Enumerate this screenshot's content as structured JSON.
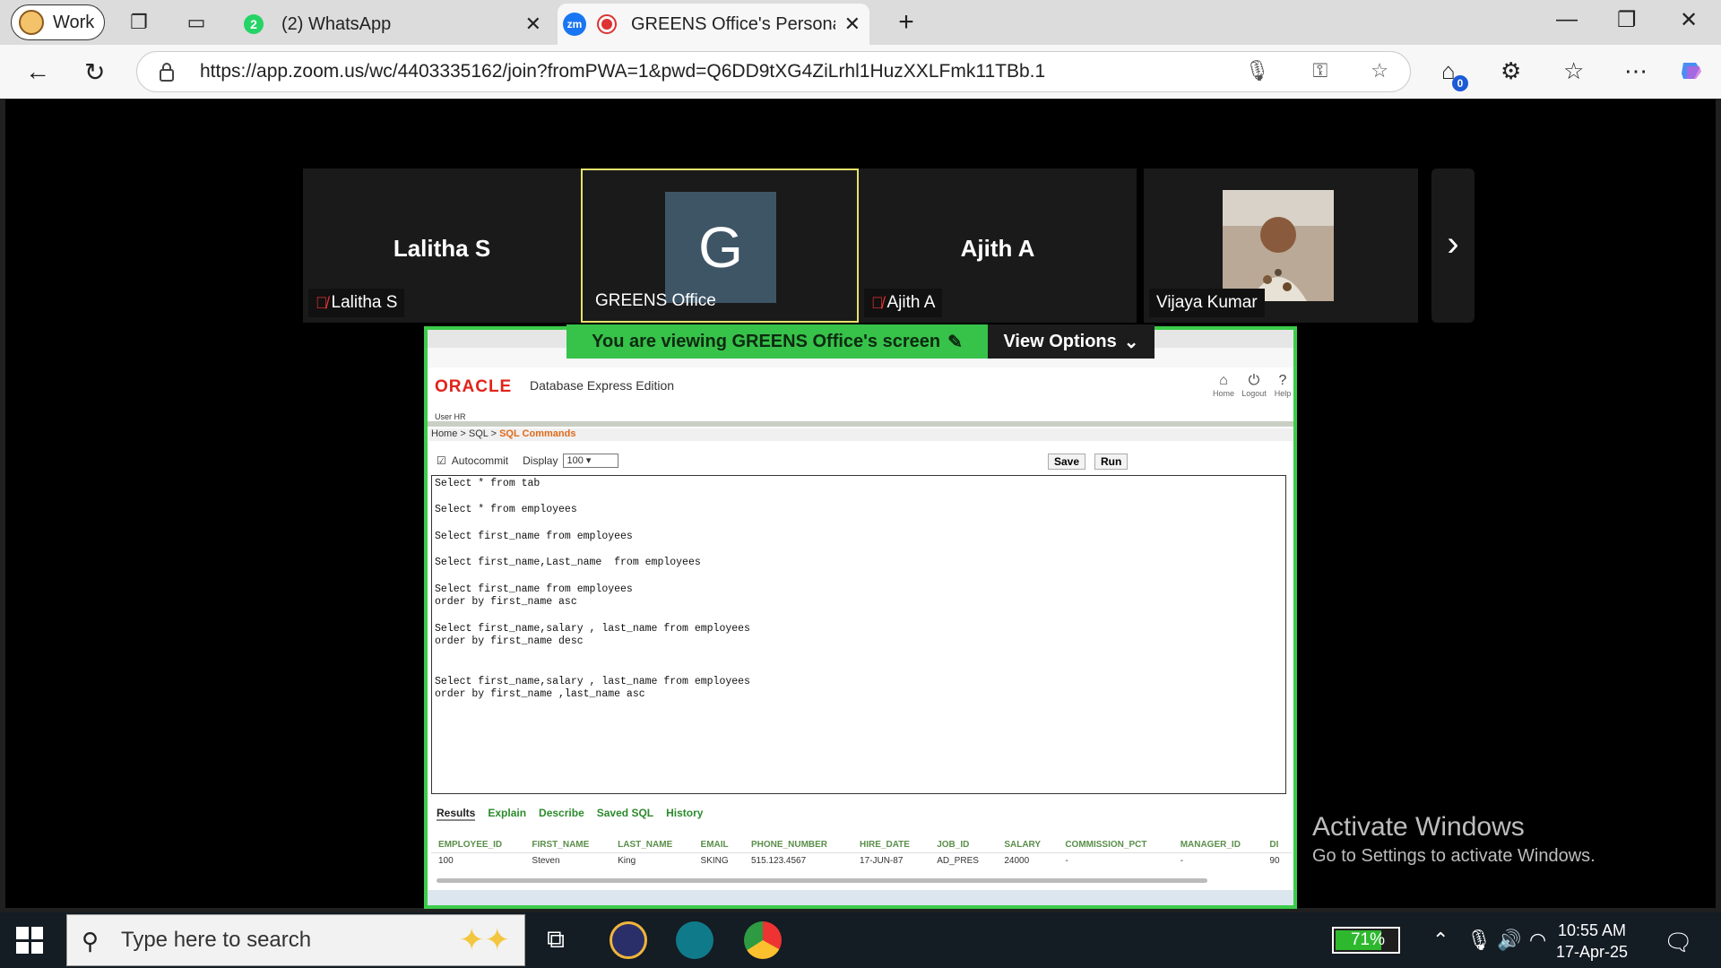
{
  "browser": {
    "profile_label": "Work",
    "tabs": [
      {
        "label": "(2) WhatsApp",
        "badge": "2"
      },
      {
        "label": "GREENS Office's Personal Me",
        "icon_text": "zm"
      }
    ],
    "url": "https://app.zoom.us/wc/4403335162/join?fromPWA=1&pwd=Q6DD9tXG4ZiLrhl1HuzXXLFmk11TBb.1",
    "extensions_badge": "0"
  },
  "meeting": {
    "participants": [
      {
        "display": "Lalitha S",
        "tag": "Lalitha S",
        "muted": true
      },
      {
        "display": "G",
        "tag": "GREENS Office",
        "muted": false
      },
      {
        "display": "Ajith A",
        "tag": "Ajith A",
        "muted": true
      },
      {
        "display": "",
        "tag": "Vijaya Kumar",
        "muted": false
      }
    ],
    "share_banner": "You are viewing  GREENS Office's screen",
    "view_options": "View Options"
  },
  "shared_screen": {
    "oracle_logo": "ORACLE",
    "product": "Database Express Edition",
    "nav": [
      "Home",
      "Logout",
      "Help"
    ],
    "user": "User HR",
    "breadcrumb": {
      "home": "Home",
      "sql": "SQL",
      "current": "SQL Commands",
      "sep": ">"
    },
    "autocommit_label": "Autocommit",
    "display_label": "Display",
    "display_value": "100",
    "save_label": "Save",
    "run_label": "Run",
    "sql_text": "Select * from tab\n\nSelect * from employees\n\nSelect first_name from employees\n\nSelect first_name,Last_name  from employees\n\nSelect first_name from employees\norder by first_name asc\n\nSelect first_name,salary , last_name from employees\norder by first_name desc\n\n\nSelect first_name,salary , last_name from employees\norder by first_name ,last_name asc",
    "result_tabs": [
      "Results",
      "Explain",
      "Describe",
      "Saved SQL",
      "History"
    ],
    "columns": [
      "EMPLOYEE_ID",
      "FIRST_NAME",
      "LAST_NAME",
      "EMAIL",
      "PHONE_NUMBER",
      "HIRE_DATE",
      "JOB_ID",
      "SALARY",
      "COMMISSION_PCT",
      "MANAGER_ID",
      "DI"
    ],
    "row": [
      "100",
      "Steven",
      "King",
      "SKING",
      "515.123.4567",
      "17-JUN-87",
      "AD_PRES",
      "24000",
      "-",
      "-",
      "90"
    ]
  },
  "watermark": {
    "line1": "Activate Windows",
    "line2": "Go to Settings to activate Windows."
  },
  "taskbar": {
    "search_placeholder": "Type here to search",
    "battery": "71%",
    "battery_level": 0.71,
    "time": "10:55 AM",
    "date": "17-Apr-25"
  }
}
